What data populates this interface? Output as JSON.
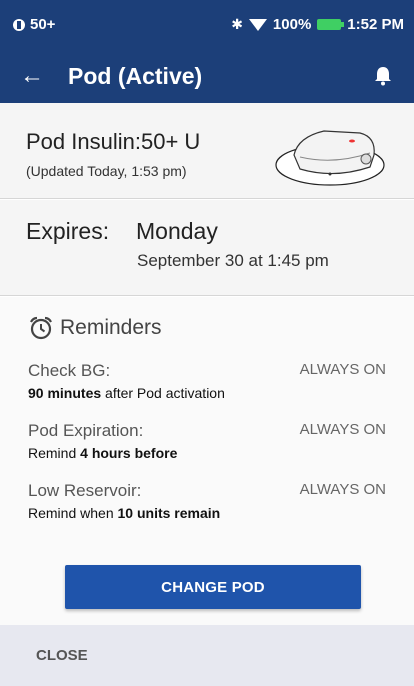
{
  "status_bar": {
    "left_text": "50+",
    "battery_percent": "100%",
    "time": "1:52 PM"
  },
  "app_bar": {
    "title": "Pod (Active)"
  },
  "insulin": {
    "label": "Pod Insulin:",
    "value": "50+ U",
    "updated": "(Updated Today, 1:53 pm)"
  },
  "expires": {
    "label": "Expires:",
    "day": "Monday",
    "date": "September 30 at 1:45 pm"
  },
  "reminders": {
    "title": "Reminders",
    "items": [
      {
        "label": "Check BG:",
        "status": "ALWAYS ON",
        "pre": "",
        "bold": "90 minutes",
        "post": " after Pod activation"
      },
      {
        "label": "Pod Expiration:",
        "status": "ALWAYS ON",
        "pre": "Remind ",
        "bold": "4 hours before",
        "post": ""
      },
      {
        "label": "Low Reservoir:",
        "status": "ALWAYS ON",
        "pre": "Remind when ",
        "bold": "10 units remain",
        "post": ""
      }
    ]
  },
  "actions": {
    "change_pod": "CHANGE POD",
    "close": "CLOSE"
  },
  "colors": {
    "brand": "#1c3f79",
    "button": "#1f54ab",
    "footer_bg": "#e7e8f0"
  },
  "icons": [
    "sim-icon",
    "bluetooth-icon",
    "wifi-icon",
    "battery-icon",
    "back-arrow-icon",
    "bell-icon",
    "alarm-clock-icon",
    "pod-device-image"
  ]
}
